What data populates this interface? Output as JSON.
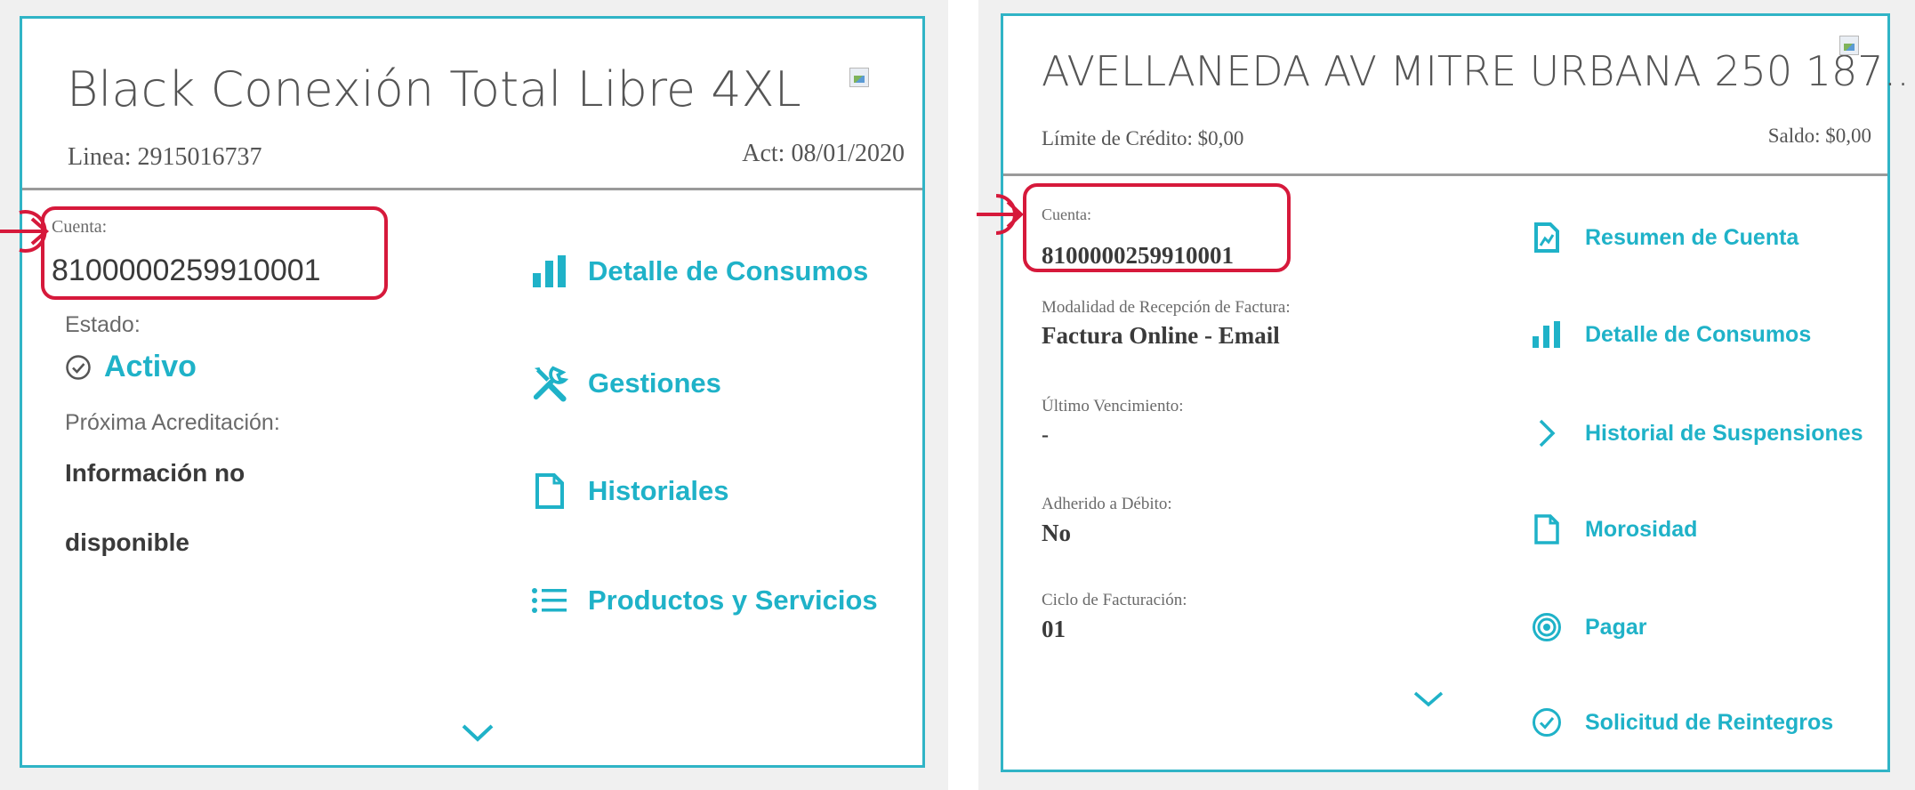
{
  "colors": {
    "accent": "#1fb2c8",
    "highlight": "#d6193b",
    "panel": "#f0f0f0"
  },
  "left_card": {
    "title": "Black Conexión Total Libre 4XL",
    "line": "Linea: 2915016737",
    "act": "Act: 08/01/2020",
    "account_label": "Cuenta:",
    "account_number": "8100000259910001",
    "status_label": "Estado:",
    "status_value": "Activo",
    "next_credit_label": "Próxima Acreditación:",
    "next_credit_value_1": "Información no",
    "next_credit_value_2": "disponible",
    "actions": [
      {
        "label": "Detalle de Consumos",
        "icon": "bar-chart-icon"
      },
      {
        "label": "Gestiones",
        "icon": "tools-icon"
      },
      {
        "label": "Historiales",
        "icon": "document-icon"
      },
      {
        "label": "Productos y Servicios",
        "icon": "list-icon"
      }
    ]
  },
  "right_card": {
    "title": "AVELLANEDA AV MITRE URBANA 250 187...",
    "credit_limit": "Límite de Crédito: $0,00",
    "balance": "Saldo: $0,00",
    "account_label": "Cuenta:",
    "account_number": "8100000259910001",
    "reception_label": "Modalidad de Recepción de Factura:",
    "reception_value": "Factura Online - Email",
    "last_due_label": "Último Vencimiento:",
    "last_due_value": "-",
    "debit_label": "Adherido a Débito:",
    "debit_value": "No",
    "cycle_label": "Ciclo de Facturación:",
    "cycle_value": "01",
    "actions": [
      {
        "label": "Resumen de Cuenta",
        "icon": "statement-icon"
      },
      {
        "label": "Detalle de Consumos",
        "icon": "bar-chart-icon"
      },
      {
        "label": "Historial de Suspensiones",
        "icon": "chevron-right-icon"
      },
      {
        "label": "Morosidad",
        "icon": "document-icon"
      },
      {
        "label": "Pagar",
        "icon": "target-icon"
      },
      {
        "label": "Solicitud de Reintegros",
        "icon": "check-circle-icon"
      }
    ]
  }
}
